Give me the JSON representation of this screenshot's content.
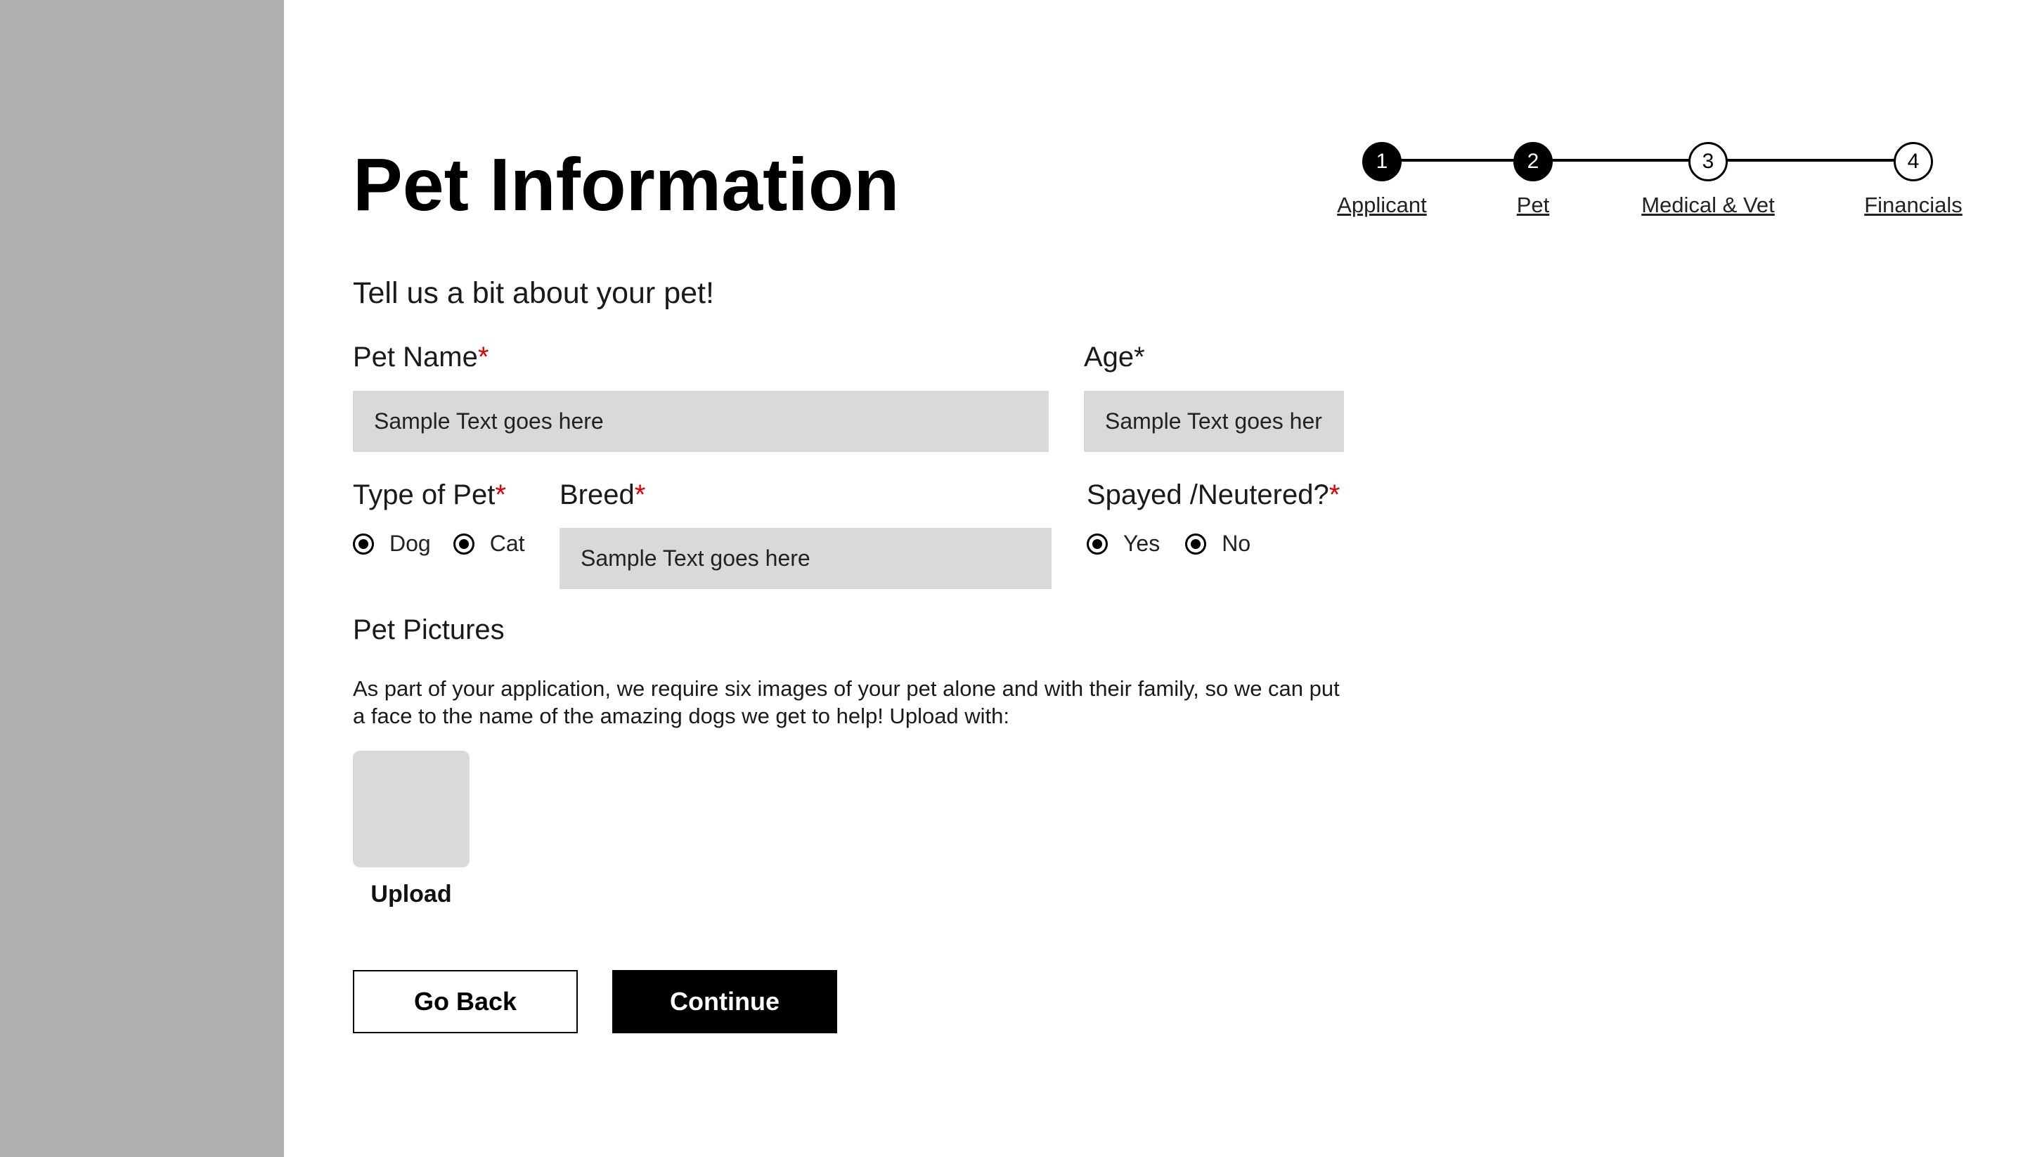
{
  "page": {
    "title": "Pet Information",
    "subtitle": "Tell us a bit about your pet!"
  },
  "stepper": {
    "steps": [
      {
        "number": "1",
        "label": "Applicant",
        "state": "complete"
      },
      {
        "number": "2",
        "label": "Pet",
        "state": "current"
      },
      {
        "number": "3",
        "label": "Medical & Vet",
        "state": "upcoming"
      },
      {
        "number": "4",
        "label": "Financials",
        "state": "upcoming"
      }
    ]
  },
  "form": {
    "pet_name": {
      "label": "Pet Name",
      "required_mark": "*",
      "placeholder": "Sample Text goes here"
    },
    "age": {
      "label": "Age*",
      "placeholder": "Sample Text goes here"
    },
    "type_of_pet": {
      "label": "Type of Pet",
      "required_mark": "*",
      "options": [
        "Dog",
        "Cat"
      ]
    },
    "breed": {
      "label": "Breed",
      "required_mark": "*",
      "placeholder": "Sample Text goes here"
    },
    "spayed_neutered": {
      "label": "Spayed /Neutered?",
      "required_mark": "*",
      "options": [
        "Yes",
        "No"
      ]
    }
  },
  "pictures": {
    "label": "Pet Pictures",
    "description": "As part of your application, we require six images of your pet alone and with their family, so we can put a face to the name of the amazing dogs we get to help! Upload with:",
    "upload_label": "Upload"
  },
  "actions": {
    "back_label": "Go Back",
    "continue_label": "Continue"
  },
  "colors": {
    "sidebar": "#afafaf",
    "field_background": "#d9d9d9",
    "required": "#e00000",
    "primary": "#000000"
  }
}
